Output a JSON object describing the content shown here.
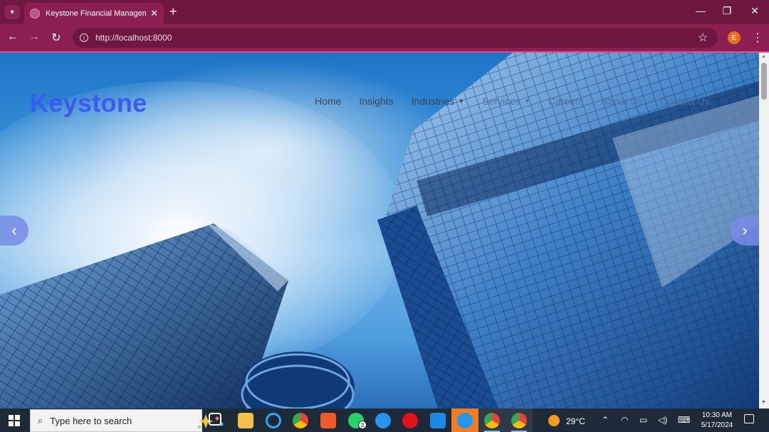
{
  "browser": {
    "tab_title": "Keystone Financial Management",
    "new_tab_symbol": "+",
    "url": "http://localhost:8000",
    "profile_initial": "E",
    "window_controls": [
      "—",
      "❐",
      "✕"
    ]
  },
  "site": {
    "logo": "Keystone",
    "nav": [
      {
        "label": "Home",
        "has_dropdown": false
      },
      {
        "label": "Insights",
        "has_dropdown": false
      },
      {
        "label": "Industries",
        "has_dropdown": true
      },
      {
        "label": "Services",
        "has_dropdown": true
      },
      {
        "label": "Careers",
        "has_dropdown": false
      },
      {
        "label": "About Us",
        "has_dropdown": false
      },
      {
        "label": "Contact Us",
        "has_dropdown": false
      }
    ],
    "carousel": {
      "prev_icon": "chevron-left-icon",
      "next_icon": "chevron-right-icon"
    }
  },
  "taskbar": {
    "search_placeholder": "Type here to search",
    "whatsapp_badge": "3",
    "weather_temp": "29°C",
    "time": "10:30 AM",
    "date": "5/17/2024"
  },
  "colors": {
    "browser_frame": "#8c1f52",
    "tabbar": "#6e1740",
    "logo": "#3b5bf0",
    "carousel_arrow": "#788ce6",
    "taskbar": "#1f2a38"
  }
}
